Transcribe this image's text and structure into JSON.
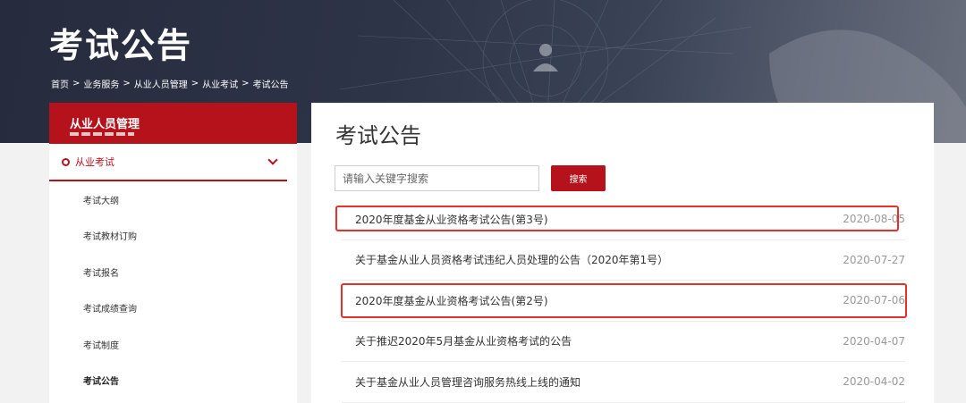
{
  "banner": {
    "title": "考试公告"
  },
  "breadcrumb": [
    "首页",
    "业务服务",
    "从业人员管理",
    "从业考试",
    "考试公告"
  ],
  "breadcrumb_separator": ">",
  "sidebar": {
    "header": "从业人员管理",
    "group_label": "从业考试",
    "items": [
      {
        "label": "考试大纲"
      },
      {
        "label": "考试教材订购"
      },
      {
        "label": "考试报名"
      },
      {
        "label": "考试成绩查询"
      },
      {
        "label": "考试制度"
      },
      {
        "label": "考试公告"
      }
    ]
  },
  "main": {
    "title": "考试公告",
    "search": {
      "placeholder": "请输入关键字搜索",
      "button_label": "搜索"
    },
    "notices": [
      {
        "title": "2020年度基金从业资格考试公告(第3号)",
        "date": "2020-08-05"
      },
      {
        "title": "关于基金从业人员资格考试违纪人员处理的公告（2020年第1号）",
        "date": "2020-07-27"
      },
      {
        "title": "2020年度基金从业资格考试公告(第2号)",
        "date": "2020-07-06"
      },
      {
        "title": "关于推迟2020年5月基金从业资格考试的公告",
        "date": "2020-04-07"
      },
      {
        "title": "关于基金从业人员管理咨询服务热线上线的通知",
        "date": "2020-04-02"
      }
    ]
  },
  "colors": {
    "accent": "#b5121b",
    "highlight": "#e4312b",
    "banner_dark": "#262b3d"
  }
}
